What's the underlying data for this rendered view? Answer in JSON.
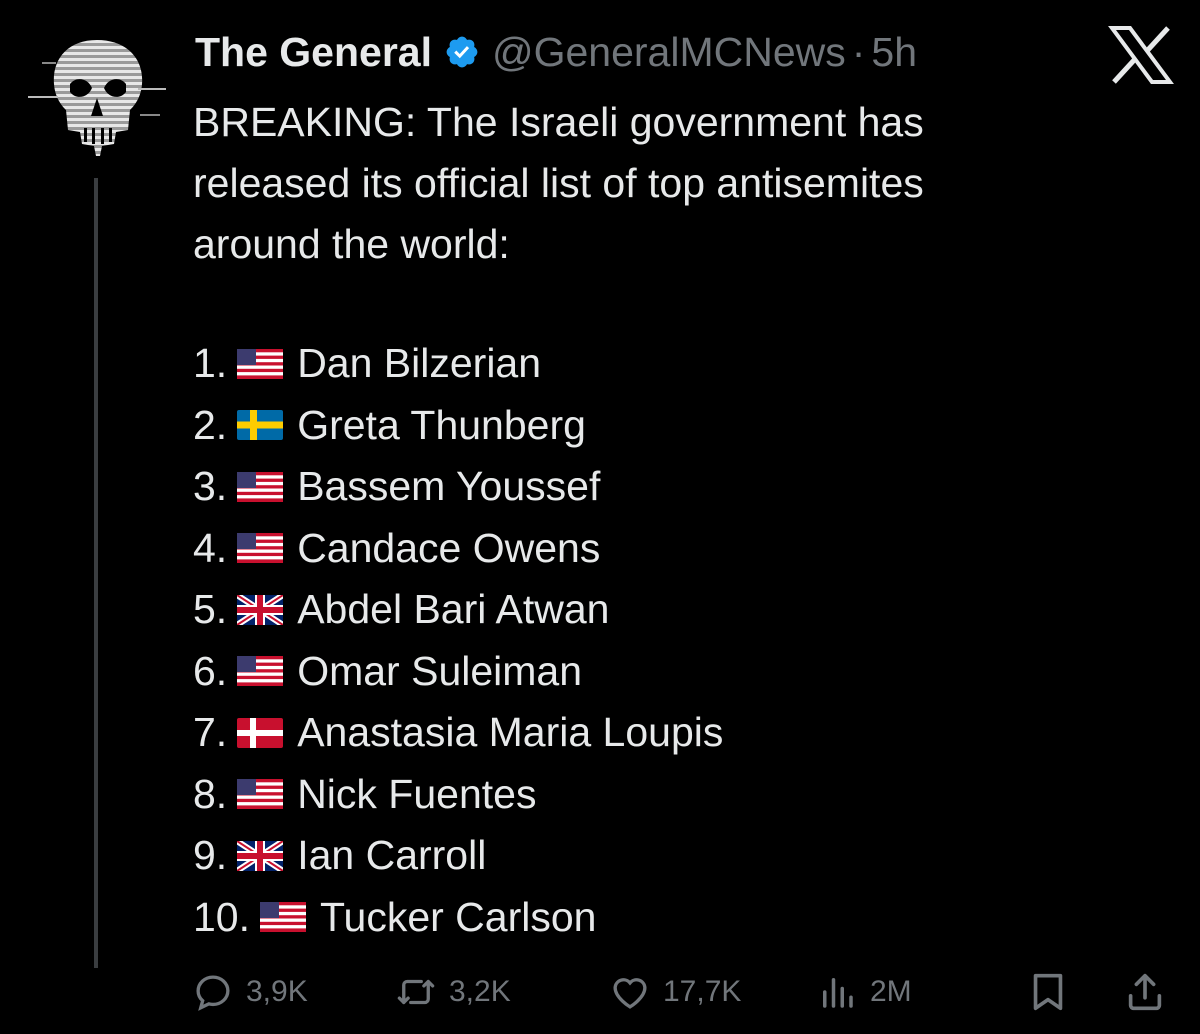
{
  "tweet": {
    "display_name": "The General",
    "handle": "@GeneralMCNews",
    "separator": "·",
    "time": "5h",
    "body_lines": [
      "BREAKING: The Israeli government has",
      "released its official list of top antisemites",
      "around the world:"
    ],
    "list": [
      {
        "num": "1.",
        "flag": "flag-us",
        "name": "Dan Bilzerian"
      },
      {
        "num": "2.",
        "flag": "flag-se",
        "name": "Greta Thunberg"
      },
      {
        "num": "3.",
        "flag": "flag-us",
        "name": "Bassem Youssef"
      },
      {
        "num": "4.",
        "flag": "flag-us",
        "name": "Candace Owens"
      },
      {
        "num": "5.",
        "flag": "flag-gb",
        "name": "Abdel Bari Atwan"
      },
      {
        "num": "6.",
        "flag": "flag-us",
        "name": "Omar Suleiman"
      },
      {
        "num": "7.",
        "flag": "flag-dk",
        "name": "Anastasia Maria Loupis"
      },
      {
        "num": "8.",
        "flag": "flag-us",
        "name": "Nick Fuentes"
      },
      {
        "num": "9.",
        "flag": "flag-gb",
        "name": "Ian Carroll"
      },
      {
        "num": "10.",
        "flag": "flag-us",
        "name": "Tucker Carlson"
      }
    ],
    "actions": {
      "replies": "3,9K",
      "reposts": "3,2K",
      "likes": "17,7K",
      "views": "2M"
    }
  },
  "colors": {
    "background": "#000000",
    "text": "#e7e9ea",
    "muted": "#71767b",
    "verified": "#1d9bf0"
  }
}
